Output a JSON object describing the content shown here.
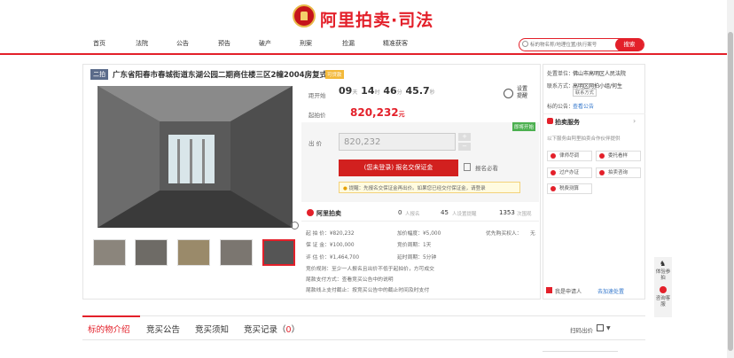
{
  "brand": {
    "title": "阿里拍卖·司法"
  },
  "nav": {
    "items": [
      "首页",
      "法院",
      "公告",
      "预告",
      "破产",
      "刑案",
      "捡漏",
      "精准获客"
    ]
  },
  "search": {
    "placeholder": "标的物名称/地理位置/执行案号",
    "button": "搜索"
  },
  "item": {
    "status_tag": "二拍",
    "title": "广东省阳春市春城街道东湖公园二期商住楼三区2幢2004房复式",
    "ribbon": "可贷款"
  },
  "auction": {
    "countdown_label": "距开始",
    "days": "09",
    "days_unit": "天",
    "hours": "14",
    "hours_unit": "时",
    "minutes": "46",
    "minutes_unit": "分",
    "seconds": "45.7",
    "seconds_unit": "秒",
    "remind": "设置提醒",
    "start_price_label": "起拍价",
    "start_price": "820,232",
    "currency_unit": "元",
    "pre_badge": "即将开始",
    "bid_label": "出 价",
    "bid_value": "820,232",
    "step_plus": "+",
    "step_minus": "−",
    "register_button": "(您未登录) 报名交保证金",
    "must_register": "报名必看",
    "tip": "提醒：先报名交保证金再出价。如果您已经交付保证金，请登录"
  },
  "stats": {
    "logo": "阿里拍卖",
    "registered": "0",
    "registered_label": "人报名",
    "reminders": "45",
    "reminders_label": "人设置提醒",
    "views": "1353",
    "views_label": "次围观"
  },
  "details": {
    "start_price": "起 拍 价：¥820,232",
    "increment": "加价幅度：¥5,000",
    "priority_buy": "优先购买权人：",
    "priority_val": "无",
    "deposit": "保 证 金：¥100,000",
    "cycle": "竞价周期：1天",
    "appraise": "评 估 价：¥1,464,700",
    "delay": "延时周期：5分钟",
    "rule1": "竞价规则：至少一人报名且出价不低于起拍价，方可成交",
    "rule2": "尾款支付方式：查看竞买公告中的说明",
    "rule3": "尾款线上支付截止：按竞买公告中的截止时间及时支付"
  },
  "side": {
    "unit_label": "处置单位：",
    "unit": "佛山市高明区人民法院",
    "contact_label": "联系方式：",
    "contact": "高明区网拍小组/何生",
    "contact_btn": "联系方式",
    "notice_label": "标的公告：",
    "notice_link": "查看公告",
    "service_title": "拍卖服务",
    "service_sub": "以下服务由阿里拍卖合作伙伴提供",
    "services": [
      "律师尽调",
      "委托看样",
      "过户办证",
      "拍卖咨询",
      "税费测算"
    ],
    "apply_text": "我是申请人",
    "apply_link": "去加速处置"
  },
  "tabs": {
    "t1": "标的物介绍",
    "t2": "竞买公告",
    "t3": "竞买须知",
    "t4": "竞买记录",
    "t4_count": "0",
    "qr": "扫码出价"
  },
  "widget": {
    "a": "体验参拍",
    "b": "咨询客服"
  },
  "colors": {
    "accent": "#e3202a",
    "green_badge": "#4cb050",
    "tag": "#5b6b8a"
  }
}
